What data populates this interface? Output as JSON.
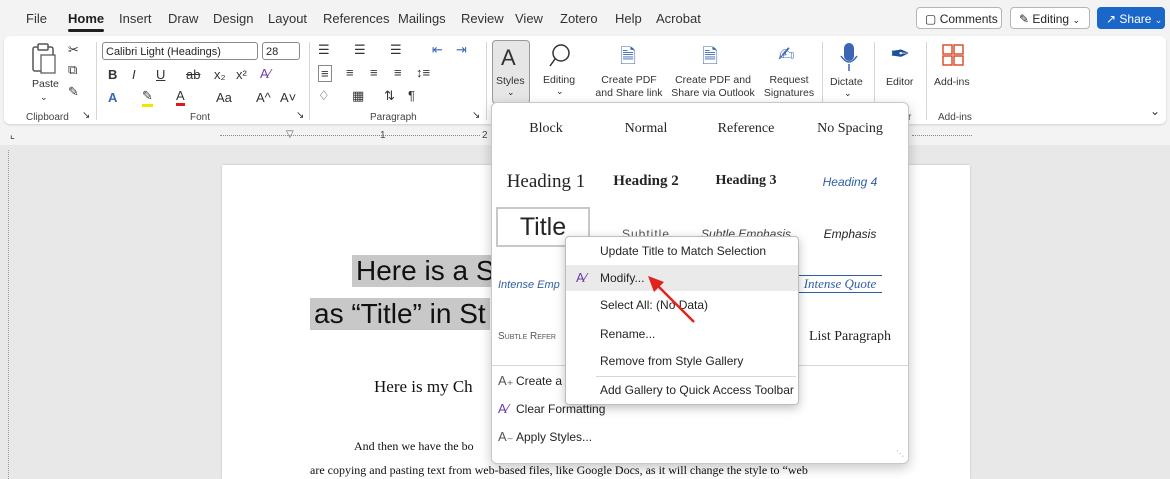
{
  "menubar": {
    "tabs": [
      "File",
      "Home",
      "Insert",
      "Draw",
      "Design",
      "Layout",
      "References",
      "Mailings",
      "Review",
      "View",
      "Zotero",
      "Help",
      "Acrobat"
    ],
    "active_tab": "Home",
    "comments_label": "Comments",
    "editing_label": "Editing",
    "share_label": "Share"
  },
  "ribbon": {
    "clipboard": {
      "paste_label": "Paste",
      "group_label": "Clipboard"
    },
    "font": {
      "font_name": "Calibri Light (Headings)",
      "font_size": "28",
      "group_label": "Font",
      "buttons": [
        "B",
        "I",
        "U",
        "ab",
        "x₂",
        "x²",
        "A",
        "A",
        "Aa",
        "A^",
        "A˅"
      ]
    },
    "paragraph": {
      "group_label": "Paragraph"
    },
    "styles": {
      "label": "Styles"
    },
    "editing": {
      "label": "Editing"
    },
    "acrobat": {
      "create_pdf_share_link": "Create PDF\nand Share link",
      "create_pdf_outlook": "Create PDF and\nShare via Outlook",
      "request_signatures": "Request\nSignatures"
    },
    "dictate": {
      "label": "Dictate"
    },
    "editor": {
      "label": "Editor"
    },
    "addins": {
      "label": "Add-ins",
      "group_label": "Add-ins"
    },
    "voice_group_fragment": "r"
  },
  "ruler": {
    "mark1": "1",
    "mark2": "2"
  },
  "document": {
    "title_line1": "Here is a S",
    "title_line2": "as “Title” in St",
    "subtitle_fragment": "Here is my Ch",
    "body_line1": "And then we have the bo",
    "body_line2": "are copying and pasting text from web-based files, like Google Docs, as it will change the style to “web"
  },
  "gallery": {
    "row1": [
      "Block",
      "Normal",
      "Reference",
      "No Spacing"
    ],
    "row2": [
      "Heading 1",
      "Heading 2",
      "Heading 3",
      "Heading 4"
    ],
    "row3": [
      "Title",
      "Subtitle",
      "Subtle Emphasis",
      "Emphasis"
    ],
    "row4_left": "Intense Emp",
    "row4_right": "Intense Quote",
    "row5_left": "Subtle Refer",
    "row5_right": "List Paragraph",
    "footer": {
      "create_style": "Create a",
      "clear_formatting": "Clear Formatting",
      "apply_styles": "Apply Styles..."
    }
  },
  "context_menu": {
    "items": [
      "Update Title to Match Selection",
      "Modify...",
      "Select All: (No Data)",
      "Rename...",
      "Remove from Style Gallery",
      "Add Gallery to Quick Access Toolbar"
    ]
  },
  "colors": {
    "accent_blue": "#1a66c9",
    "annotation_arrow": "#e0231c",
    "heading4_blue": "#2f5ea3"
  }
}
